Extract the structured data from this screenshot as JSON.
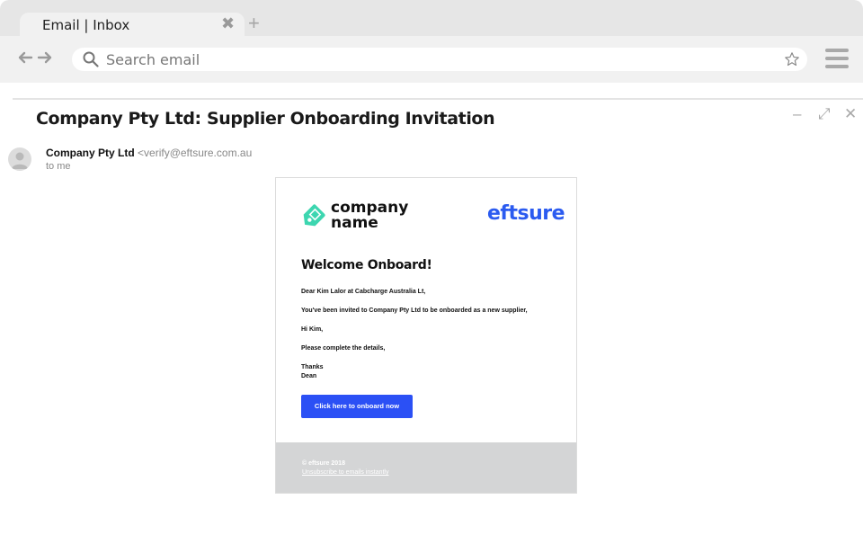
{
  "tab": {
    "title": "Email | Inbox",
    "close": "✖",
    "new": "+"
  },
  "search": {
    "placeholder": "Search email"
  },
  "email": {
    "subject": "Company Pty Ltd: Supplier Onboarding Invitation",
    "sender_name": "Company Pty Ltd",
    "sender_email": "<verify@eftsure.com.au",
    "recipient": "to me",
    "window_controls": {
      "minimize": "–",
      "expand": "⤢",
      "close": "✕"
    }
  },
  "message": {
    "logo_line1": "company",
    "logo_line2": "name",
    "brand": "eftsure",
    "heading": "Welcome Onboard!",
    "lines": [
      "Dear Kim Lalor at Cabcharge Australia Lt,",
      "You've been invited to Company Pty Ltd to be onboarded as a new supplier,",
      "Hi Kim,",
      "Please complete the details,",
      "Thanks",
      "Dean"
    ],
    "cta": "Click here to onboard now",
    "footer_copyright": "© eftsure 2018",
    "footer_unsubscribe": "Unsubscribe to emails instantly"
  },
  "colors": {
    "accent": "#2b50f5",
    "brand": "#2b5bf0",
    "logo": "#3dd6b0",
    "footer": "#d4d5d6"
  },
  "icons": [
    "back-arrow-icon",
    "forward-arrow-icon",
    "search-icon",
    "star-icon",
    "hamburger-menu-icon",
    "avatar-icon",
    "tag-logo-icon"
  ]
}
